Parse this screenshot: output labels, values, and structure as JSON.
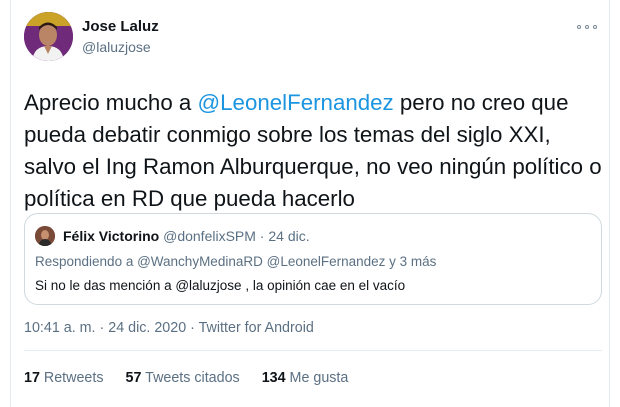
{
  "author": {
    "name": "Jose Laluz",
    "handle": "@laluzjose"
  },
  "tweet": {
    "text_before": "Aprecio mucho a ",
    "mention": "@LeonelFernandez",
    "text_after": " pero no creo que pueda debatir conmigo sobre los temas del siglo XXI, salvo el Ing Ramon Alburquerque, no veo ningún político o política en RD que pueda hacerlo"
  },
  "quote": {
    "name": "Félix Victorino",
    "handle": "@donfelixSPM",
    "separator": " · ",
    "date": "24 dic.",
    "reply_prefix": "Respondiendo a ",
    "reply_to_1": "@WanchyMedinaRD",
    "reply_to_2": "@LeonelFernandez",
    "reply_suffix": " y 3 más",
    "text": "Si no le das mención a @laluzjose , la opinión cae en el vacío"
  },
  "meta": {
    "time": "10:41 a. m.",
    "date": "24 dic. 2020",
    "source": "Twitter for Android",
    "separator": " · "
  },
  "stats": {
    "retweets_count": "17",
    "retweets_label": "Retweets",
    "quotes_count": "57",
    "quotes_label": "Tweets citados",
    "likes_count": "134",
    "likes_label": "Me gusta"
  },
  "colors": {
    "accent": "#1b95e0",
    "secondary_text": "#5b7083",
    "border": "#e6ecf0"
  },
  "icons": {
    "more": "more-horizontal-icon"
  }
}
